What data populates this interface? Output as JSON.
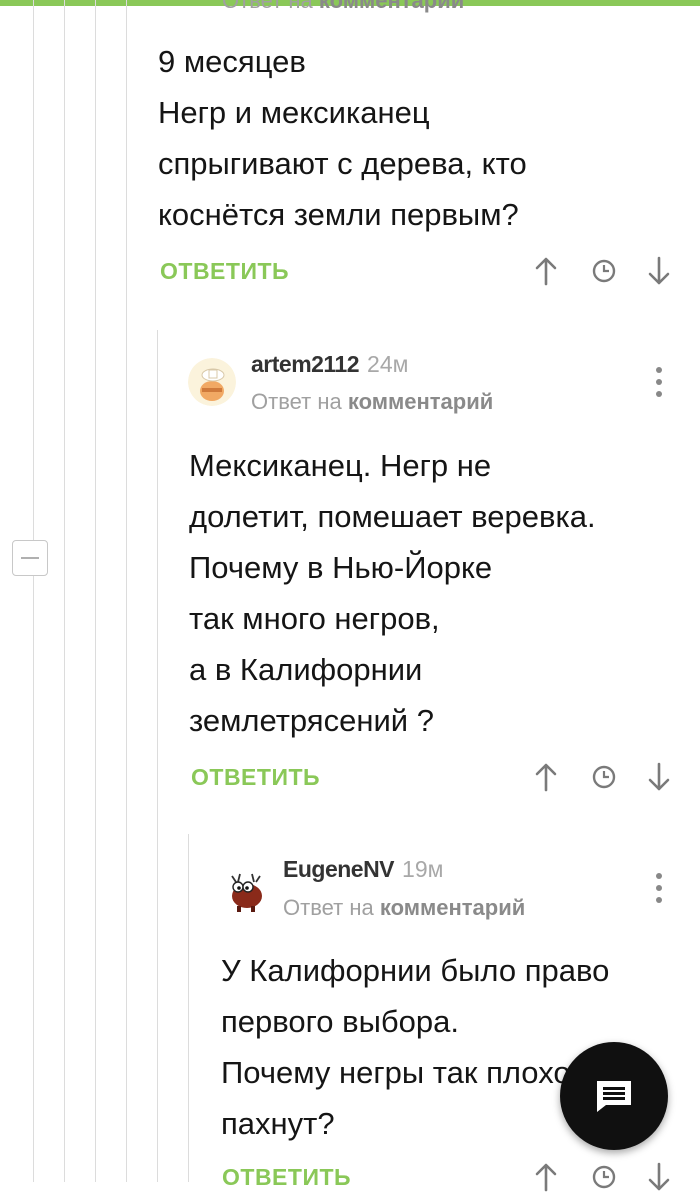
{
  "top_partial": {
    "reply_to_prefix": "Ответ на",
    "reply_to_link": "комментарий"
  },
  "comments": [
    {
      "text": "9 месяцев\nНегр и мексиканец\nспрыгивают с дерева, кто\nкоснётся земли первым?",
      "reply_label": "ОТВЕТИТЬ"
    },
    {
      "author": "artem2112",
      "time": "24м",
      "reply_to_prefix": "Ответ на",
      "reply_to_link": "комментарий",
      "text": "Мексиканец. Негр не\nдолетит, помешает веревка.\nПочему в Нью-Йорке\nтак много негров,\nа в Калифорнии\nземлетрясений ?",
      "reply_label": "ОТВЕТИТЬ"
    },
    {
      "author": "EugeneNV",
      "time": "19м",
      "reply_to_prefix": "Ответ на",
      "reply_to_link": "комментарий",
      "text": "У Калифорнии было право\nпервого выбора.\nПочему негры так плохо\nпахнут?",
      "reply_label": "ОТВЕТИТЬ"
    }
  ],
  "icons": {
    "upvote": "arrow-up-icon",
    "time": "clock-icon",
    "downvote": "arrow-down-icon",
    "more": "kebab-menu-icon",
    "collapse": "minus-icon",
    "fab": "comment-icon"
  },
  "colors": {
    "accent": "#8ac858",
    "text": "#151515",
    "muted": "#a0a0a0",
    "fab": "#101010"
  }
}
